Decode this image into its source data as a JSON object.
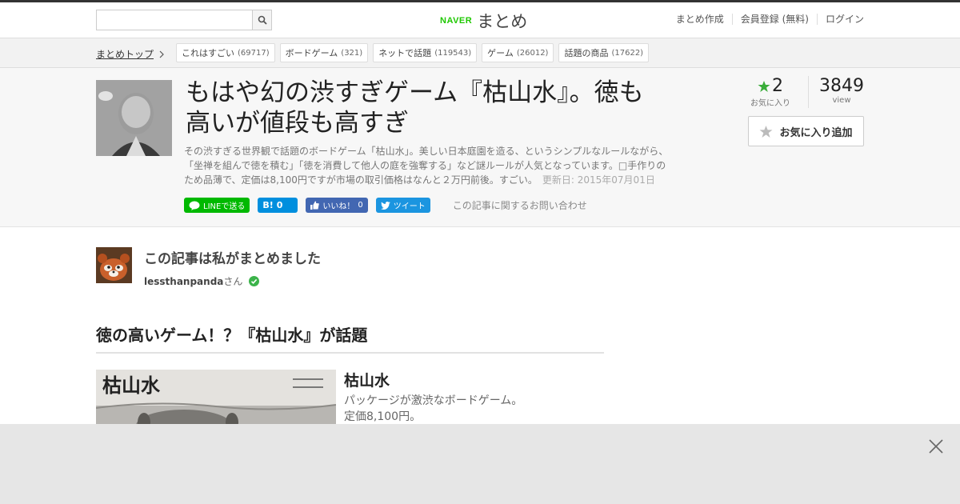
{
  "header": {
    "brand_naver": "NAVER",
    "brand_matome": "まとめ",
    "nav": [
      "まとめ作成",
      "会員登録 (無料)",
      "ログイン"
    ]
  },
  "breadcrumb": {
    "home": "まとめトップ"
  },
  "tags": [
    {
      "label": "これはすごい",
      "count": "(69717)"
    },
    {
      "label": "ボードゲーム",
      "count": "(321)"
    },
    {
      "label": "ネットで話題",
      "count": "(119543)"
    },
    {
      "label": "ゲーム",
      "count": "(26012)"
    },
    {
      "label": "話題の商品",
      "count": "(17622)"
    }
  ],
  "article": {
    "title": "もはや幻の渋すぎゲーム『枯山水』。徳も高いが値段も高すぎ",
    "description": "その渋すぎる世界観で話題のボードゲーム「枯山水」。美しい日本庭園を造る、というシンプルなルールながら、「坐禅を組んで徳を積む」「徳を消費して他人の庭を強奪する」など謎ルールが人気となっています。□手作りのため品薄で、定価は8,100円ですが市場の取引価格はなんと２万円前後。すごい。",
    "updated": "更新日: 2015年07月01日"
  },
  "share": {
    "line": "LINEで送る",
    "hatena_count": "0",
    "fb_label": "いいね！",
    "fb_count": "0",
    "tweet": "ツイート",
    "inquiry": "この記事に関するお問い合わせ"
  },
  "stats": {
    "fav_count": "2",
    "fav_label": "お気に入り",
    "view_count": "3849",
    "view_label": "view",
    "fav_button": "お気に入り追加"
  },
  "author": {
    "heading": "この記事は私がまとめました",
    "name": "lessthanpanda",
    "suffix": "さん"
  },
  "section": {
    "heading": "徳の高いゲーム！？『枯山水』が話題"
  },
  "item": {
    "title": "枯山水",
    "line1": "パッケージが激渋なボードゲーム。",
    "line2": "定価8,100円。",
    "image_text": "枯山水"
  },
  "colors": {
    "line_green": "#00b900",
    "hatena_blue": "#008fde",
    "fb_blue": "#4267b2",
    "twitter_blue": "#1b95e0",
    "naver_green": "#1ec800"
  }
}
